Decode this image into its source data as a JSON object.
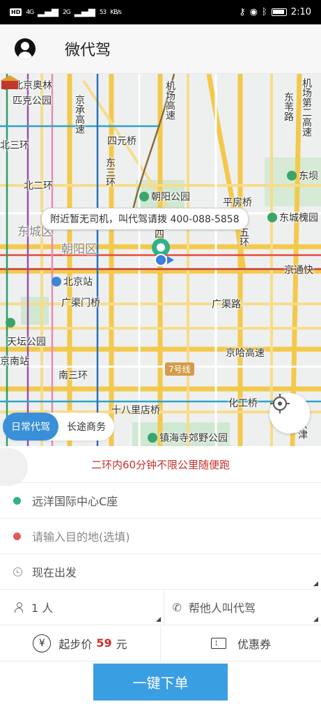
{
  "status_bar": {
    "network_tag": "HD",
    "signal_1": "4G",
    "signal_2": "2G",
    "net_speed": "53",
    "net_speed_unit": "KB/s",
    "time": "2:10"
  },
  "header": {
    "title": "微代驾",
    "avatar_icon": "user-avatar-icon"
  },
  "map": {
    "notice": "附近暂无司机，叫代驾请拨 400-088-5858",
    "metro_badge": "7号线",
    "labels": {
      "aolin": "北京奥林",
      "aolin2": "匹克公园",
      "beisanhuan": "北三环",
      "beierhuan": "北二环",
      "dongcheng": "东城区",
      "chaoyang": "朝阳区",
      "sanyuan": "四元桥",
      "jingcheng": "京承高速",
      "jichang": "机场高速",
      "dongsihuan": "东三环",
      "chaoyang_park": "朝阳公园",
      "pingfangqiao": "平房桥",
      "dongwuhuan": "东五环",
      "changying": "东城槐园",
      "dongfeng": "东苇路",
      "erhao": "机场第二高速",
      "dongba": "东坝",
      "si": "四",
      "wuhuan": "五环",
      "beijing_station": "北京站",
      "guangqumen": "广渠门桥",
      "guangqulu": "广渠路",
      "jingtong": "京通快",
      "tiantan": "天坛公园",
      "nanzhan": "京南站",
      "nansanhuan": "南三环",
      "jingha": "京哈高速",
      "shibali": "十八里店桥",
      "huagong": "化工桥",
      "zhenhai": "镇海寺郊野公园",
      "jingjin": "京津"
    }
  },
  "service_tabs": [
    {
      "label": "日常代驾",
      "active": true
    },
    {
      "label": "长途商务",
      "active": false
    }
  ],
  "panel": {
    "promo": "二环内60分钟不限公里随便跑",
    "pickup": "远洋国际中心C座",
    "destination_placeholder": "请输入目的地(选填)",
    "depart_time": "现在出发",
    "passengers": "1 人",
    "call_for_other": "帮他人叫代驾",
    "price_prefix": "起步价",
    "price_value": "59",
    "price_unit": "元",
    "coupon": "优惠券",
    "order_button": "一键下单"
  },
  "colors": {
    "accent": "#3a9ee2",
    "promo_red": "#c9302c",
    "pickup_green": "#2fb08a",
    "dest_red": "#e05a5a"
  }
}
